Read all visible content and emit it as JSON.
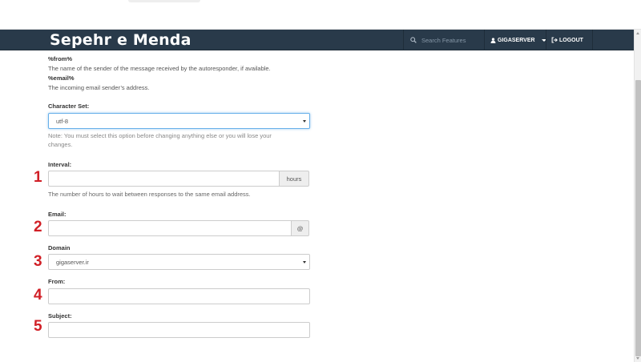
{
  "header": {
    "brand": "Sepehr e Menda",
    "search_placeholder": "Search Features",
    "user_label": "GIGASERVER",
    "logout_label": "LOGOUT"
  },
  "vars": [
    {
      "name": "%from%",
      "description": "The name of the sender of the message received by the autoresponder, if available."
    },
    {
      "name": "%email%",
      "description": "The incoming email sender’s address."
    }
  ],
  "charset": {
    "label": "Character Set:",
    "value": "utf-8",
    "note_line1": "Note: You must select this option before changing anything else or you will lose your",
    "note_line2": "changes."
  },
  "interval": {
    "label": "Interval:",
    "value": "",
    "addon": "hours",
    "help": "The number of hours to wait between responses to the same email address."
  },
  "email": {
    "label": "Email:",
    "value": "",
    "addon": "@"
  },
  "domain": {
    "label": "Domain",
    "value": "gigaserver.ir"
  },
  "from": {
    "label": "From:",
    "value": ""
  },
  "subject": {
    "label": "Subject:",
    "value": ""
  },
  "markers": [
    "1",
    "2",
    "3",
    "4",
    "5"
  ],
  "colors": {
    "navbar": "#293a4a",
    "marker": "#d11f26",
    "focus": "#66afe9"
  }
}
